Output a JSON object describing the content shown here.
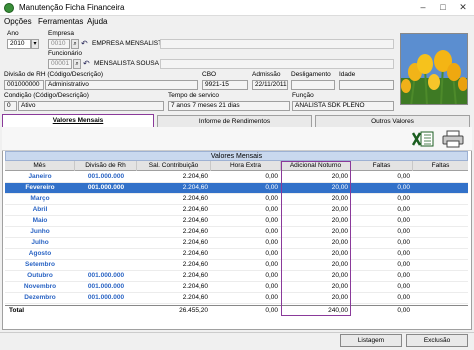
{
  "window": {
    "title": "Manutenção Ficha Financeira",
    "minimize": "–",
    "maximize": "□",
    "close": "✕"
  },
  "menu": [
    "Opções",
    "Ferramentas",
    "Ajuda"
  ],
  "form": {
    "ano_label": "Ano",
    "ano_value": "2010",
    "empresa_label": "Empresa",
    "empresa_code": "0010",
    "empresa_name": "EMPRESA MENSALISTA",
    "funcionario_label": "Funcionário",
    "funcionario_code": "00001",
    "funcionario_name": "MENSALISTA SOUSA",
    "divisao_label": "Divisão de RH (Código/Descrição)",
    "divisao_code": "001000000",
    "divisao_desc": "Administrativo",
    "cbo_label": "CBO",
    "cbo_value": "9921-15",
    "admissao_label": "Admissão",
    "admissao_value": "22/11/2011",
    "desligamento_label": "Desligamento",
    "desligamento_value": "",
    "idade_label": "Idade",
    "idade_value": "",
    "condicao_label": "Condição (Código/Descrição)",
    "condicao_code": "0",
    "condicao_desc": "Ativo",
    "tempo_label": "Tempo de servico",
    "tempo_value": "7 anos 7 meses 21 dias",
    "funcao_label": "Função",
    "funcao_value": "ANALISTA SDK PLENO"
  },
  "tabs": [
    {
      "label": "Valores Mensais",
      "active": true
    },
    {
      "label": "Informe de Rendimentos",
      "active": false
    },
    {
      "label": "Outros Valores",
      "active": false
    }
  ],
  "grid": {
    "title": "Valores Mensais",
    "columns": [
      "Mês",
      "Divisão de Rh",
      "Sal. Contribuição",
      "Hora Extra",
      "Adicional Noturno",
      "Faltas",
      "Faltas"
    ],
    "rows": [
      {
        "mes": "Janeiro",
        "div": "001.000.000",
        "sal": "2.204,60",
        "he": "0,00",
        "an": "20,00",
        "f1": "0,00",
        "f2": "",
        "selected": false
      },
      {
        "mes": "Fevereiro",
        "div": "001.000.000",
        "sal": "2.204,60",
        "he": "0,00",
        "an": "20,00",
        "f1": "0,00",
        "f2": "",
        "selected": true
      },
      {
        "mes": "Março",
        "div": "",
        "sal": "2.204,60",
        "he": "0,00",
        "an": "20,00",
        "f1": "0,00",
        "f2": "",
        "selected": false
      },
      {
        "mes": "Abril",
        "div": "",
        "sal": "2.204,60",
        "he": "0,00",
        "an": "20,00",
        "f1": "0,00",
        "f2": "",
        "selected": false
      },
      {
        "mes": "Maio",
        "div": "",
        "sal": "2.204,60",
        "he": "0,00",
        "an": "20,00",
        "f1": "0,00",
        "f2": "",
        "selected": false
      },
      {
        "mes": "Junho",
        "div": "",
        "sal": "2.204,60",
        "he": "0,00",
        "an": "20,00",
        "f1": "0,00",
        "f2": "",
        "selected": false
      },
      {
        "mes": "Julho",
        "div": "",
        "sal": "2.204,60",
        "he": "0,00",
        "an": "20,00",
        "f1": "0,00",
        "f2": "",
        "selected": false
      },
      {
        "mes": "Agosto",
        "div": "",
        "sal": "2.204,60",
        "he": "0,00",
        "an": "20,00",
        "f1": "0,00",
        "f2": "",
        "selected": false
      },
      {
        "mes": "Setembro",
        "div": "",
        "sal": "2.204,60",
        "he": "0,00",
        "an": "20,00",
        "f1": "0,00",
        "f2": "",
        "selected": false
      },
      {
        "mes": "Outubro",
        "div": "001.000.000",
        "sal": "2.204,60",
        "he": "0,00",
        "an": "20,00",
        "f1": "0,00",
        "f2": "",
        "selected": false
      },
      {
        "mes": "Novembro",
        "div": "001.000.000",
        "sal": "2.204,60",
        "he": "0,00",
        "an": "20,00",
        "f1": "0,00",
        "f2": "",
        "selected": false
      },
      {
        "mes": "Dezembro",
        "div": "001.000.000",
        "sal": "2.204,60",
        "he": "0,00",
        "an": "20,00",
        "f1": "0,00",
        "f2": "",
        "selected": false
      }
    ],
    "total": {
      "label": "Total",
      "sal": "26.455,20",
      "he": "0,00",
      "an": "240,00",
      "f1": "0,00"
    }
  },
  "buttons": {
    "listagem": "Listagem",
    "exclusao": "Exclusão"
  },
  "icons": {
    "excel": "excel-icon",
    "print": "printer-icon"
  }
}
